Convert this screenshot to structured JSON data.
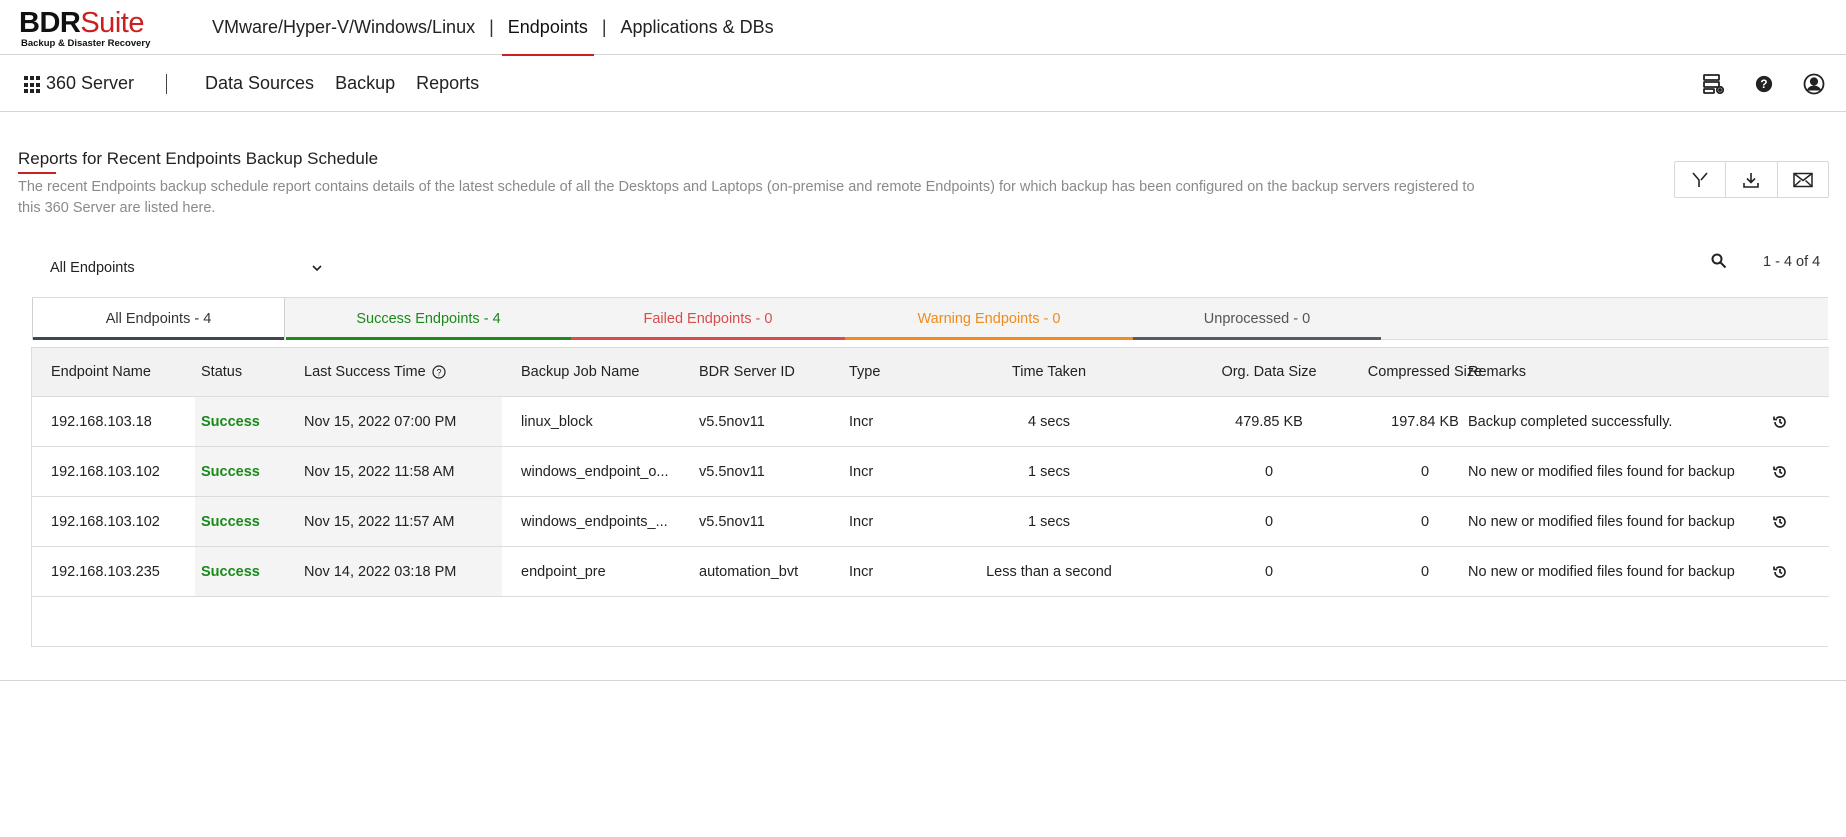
{
  "brand": {
    "name_part1": "BDR",
    "name_part2": "Suite",
    "tagline": "Backup & Disaster Recovery",
    "accent": "#cc1f1f"
  },
  "top_nav": {
    "items": [
      {
        "label": "VMware/Hyper-V/Windows/Linux",
        "active": false
      },
      {
        "label": "Endpoints",
        "active": true
      },
      {
        "label": "Applications & DBs",
        "active": false
      }
    ],
    "separator": "|"
  },
  "sub_nav": {
    "server_label": "360 Server",
    "items": [
      {
        "label": "Data Sources"
      },
      {
        "label": "Backup"
      },
      {
        "label": "Reports"
      }
    ],
    "icons": [
      "server-settings-icon",
      "help-icon",
      "user-icon"
    ]
  },
  "page": {
    "title": "Reports for Recent Endpoints Backup Schedule",
    "description": "The recent Endpoints backup schedule report contains details of the latest schedule of all the Desktops and Laptops (on-premise and remote Endpoints) for which backup has been configured on the backup servers registered to this 360 Server are listed here.",
    "actions": [
      "filter-icon",
      "download-icon",
      "mail-icon"
    ]
  },
  "filter": {
    "selected": "All Endpoints",
    "pager": "1 - 4 of 4"
  },
  "tabs": [
    {
      "label": "All Endpoints  -  4",
      "color": "#333333"
    },
    {
      "label": "Success Endpoints  -  4",
      "color": "#1a8a1a"
    },
    {
      "label": "Failed Endpoints  -  0",
      "color": "#d94c4c"
    },
    {
      "label": "Warning Endpoints  -  0",
      "color": "#f08b1c"
    },
    {
      "label": "Unprocessed  -  0",
      "color": "#555555"
    }
  ],
  "table": {
    "columns": [
      "Endpoint Name",
      "Status",
      "Last Success Time",
      "Backup Job Name",
      "BDR Server ID",
      "Type",
      "Time Taken",
      "Org. Data Size",
      "Compressed Size",
      "Remarks"
    ],
    "rows": [
      {
        "name": "192.168.103.18",
        "status": "Success",
        "time": "Nov 15, 2022 07:00 PM",
        "job": "linux_block",
        "server": "v5.5nov11",
        "type": "Incr",
        "taken": "4 secs",
        "org": "479.85 KB",
        "comp": "197.84 KB",
        "remarks": "Backup completed successfully."
      },
      {
        "name": "192.168.103.102",
        "status": "Success",
        "time": "Nov 15, 2022 11:58 AM",
        "job": "windows_endpoint_o...",
        "server": "v5.5nov11",
        "type": "Incr",
        "taken": "1 secs",
        "org": "0",
        "comp": "0",
        "remarks": "No new or modified files found for backup"
      },
      {
        "name": "192.168.103.102",
        "status": "Success",
        "time": "Nov 15, 2022 11:57 AM",
        "job": "windows_endpoints_...",
        "server": "v5.5nov11",
        "type": "Incr",
        "taken": "1 secs",
        "org": "0",
        "comp": "0",
        "remarks": "No new or modified files found for backup"
      },
      {
        "name": "192.168.103.235",
        "status": "Success",
        "time": "Nov 14, 2022 03:18 PM",
        "job": "endpoint_pre",
        "server": "automation_bvt",
        "type": "Incr",
        "taken": "Less than a second",
        "org": "0",
        "comp": "0",
        "remarks": "No new or modified files found for backup"
      }
    ],
    "status_color": "#1a8a1a",
    "row_action_icon": "history-icon"
  }
}
